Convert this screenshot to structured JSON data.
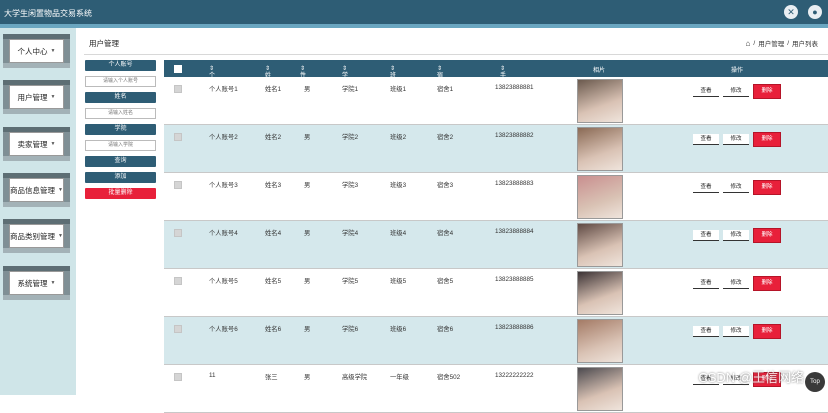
{
  "app": {
    "title": "大学生闲置物品交易系统",
    "header_icons": [
      "close-icon",
      "user-icon"
    ]
  },
  "sidebar": {
    "items": [
      {
        "label": "个人中心"
      },
      {
        "label": "用户管理"
      },
      {
        "label": "卖家管理"
      },
      {
        "label": "商品信息管理"
      },
      {
        "label": "商品类别管理"
      },
      {
        "label": "系统管理"
      }
    ]
  },
  "page": {
    "title": "用户管理",
    "breadcrumb": [
      "用户管理",
      "用户列表"
    ]
  },
  "search": {
    "account_label": "个人账号",
    "account_placeholder": "请输入个人账号",
    "name_label": "姓名",
    "name_placeholder": "请输入姓名",
    "college_label": "学院",
    "college_placeholder": "请输入学院",
    "query_label": "查询",
    "add_label": "添加",
    "batch_delete_label": "批量删除"
  },
  "table": {
    "columns": [
      "个人账号",
      "姓名",
      "性别",
      "学院",
      "班级",
      "宿舍",
      "手机号码",
      "相片",
      "操作"
    ],
    "actions": {
      "view": "查看",
      "edit": "修改",
      "delete": "删除"
    },
    "rows": [
      {
        "account": "个人账号1",
        "name": "姓名1",
        "gender": "男",
        "college": "学院1",
        "class": "班级1",
        "dorm": "宿舍1",
        "phone": "13823888881"
      },
      {
        "account": "个人账号2",
        "name": "姓名2",
        "gender": "男",
        "college": "学院2",
        "class": "班级2",
        "dorm": "宿舍2",
        "phone": "13823888882"
      },
      {
        "account": "个人账号3",
        "name": "姓名3",
        "gender": "男",
        "college": "学院3",
        "class": "班级3",
        "dorm": "宿舍3",
        "phone": "13823888883"
      },
      {
        "account": "个人账号4",
        "name": "姓名4",
        "gender": "男",
        "college": "学院4",
        "class": "班级4",
        "dorm": "宿舍4",
        "phone": "13823888884"
      },
      {
        "account": "个人账号5",
        "name": "姓名5",
        "gender": "男",
        "college": "学院5",
        "class": "班级5",
        "dorm": "宿舍5",
        "phone": "13823888885"
      },
      {
        "account": "个人账号6",
        "name": "姓名6",
        "gender": "男",
        "college": "学院6",
        "class": "班级6",
        "dorm": "宿舍6",
        "phone": "13823888886"
      },
      {
        "account": "11",
        "name": "张三",
        "gender": "男",
        "college": "高级学院",
        "class": "一年级",
        "dorm": "宿舍502",
        "phone": "13222222222"
      }
    ]
  },
  "watermark": "CSDN @王信网络",
  "to_top_label": "Top"
}
